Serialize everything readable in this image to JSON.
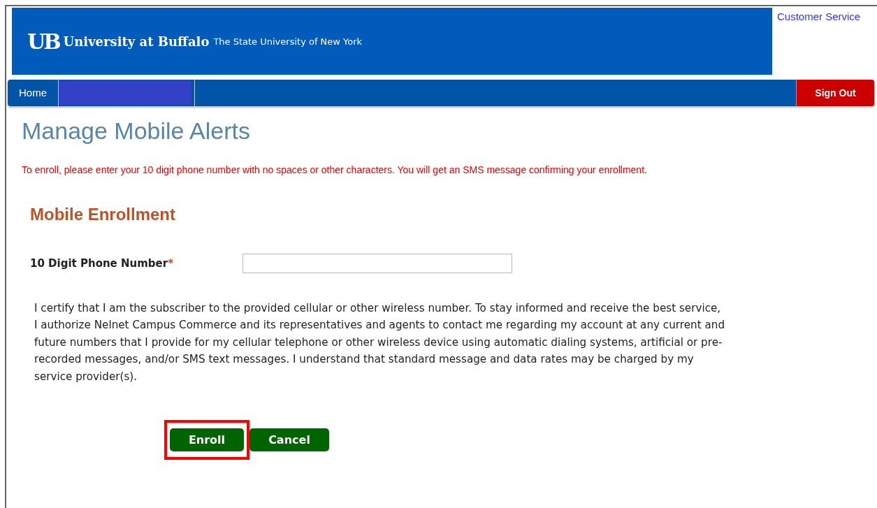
{
  "header": {
    "logo_mark": "UB",
    "university": "University at Buffalo",
    "subtitle": "The State University of New York",
    "customer_service": "Customer Service"
  },
  "nav": {
    "items": [
      {
        "kind": "link",
        "label": "Home"
      },
      {
        "kind": "redacted"
      }
    ],
    "sign_out": "Sign Out"
  },
  "page_title": "Manage Mobile Alerts",
  "instruction": "To enroll, please enter your 10 digit phone number with no spaces or other characters. You will get an SMS message confirming your enrollment.",
  "section_title": "Mobile Enrollment",
  "phone_field": {
    "label": "10 Digit Phone Number",
    "required_mark": "*"
  },
  "consent": "I certify that I am the subscriber to the provided cellular or other wireless number. To stay informed and receive the best service, I authorize Nelnet Campus Commerce and its representatives and agents to contact me regarding my account at any current and future numbers that I provide for my cellular telephone or other wireless device using automatic dialing systems, artificial or pre-recorded messages, and/or SMS text messages. I understand that standard message and data rates may be charged by my service provider(s).",
  "buttons": [
    {
      "label": "Enroll",
      "highlighted": true
    },
    {
      "label": "Cancel",
      "highlighted": false
    }
  ]
}
